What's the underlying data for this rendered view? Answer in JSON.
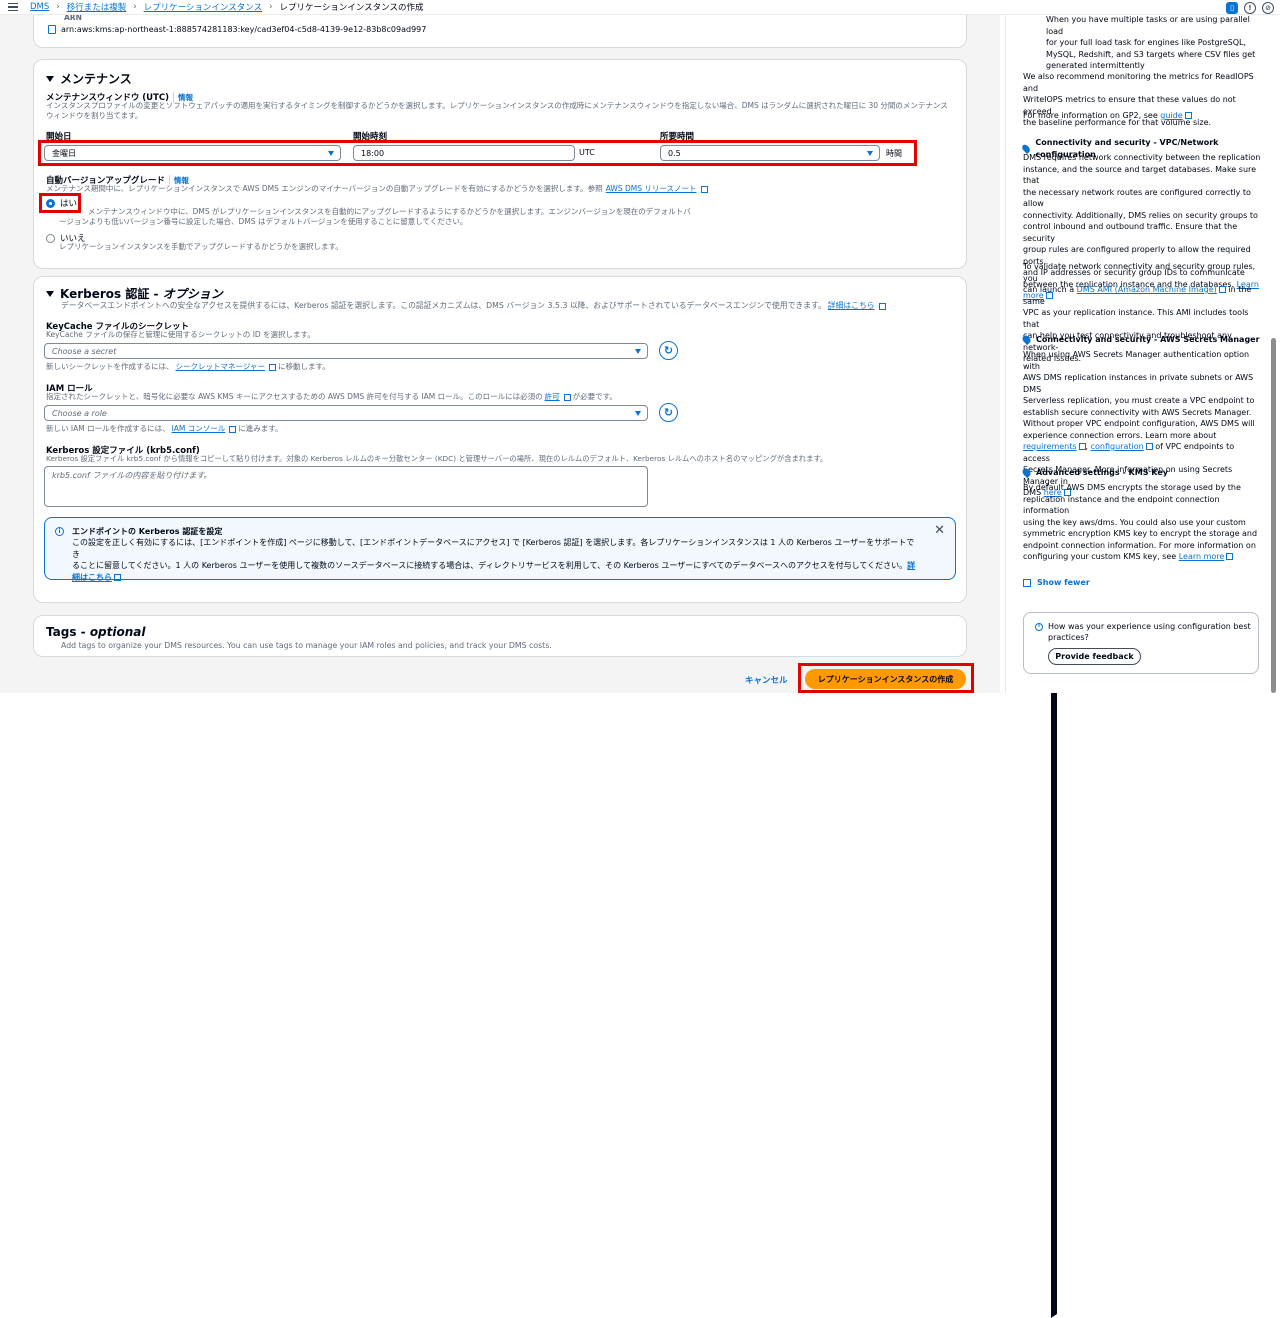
{
  "breadcrumb": {
    "root": "DMS",
    "level1": "移行または複製",
    "level2": "レプリケーションインスタンス",
    "current": "レプリケーションインスタンスの作成"
  },
  "arn": {
    "label": "ARN",
    "value": "arn:aws:kms:ap-northeast-1:888574281183:key/cad3ef04-c5d8-4139-9e12-83b8c09ad997"
  },
  "maintenance": {
    "title": "メンテナンス",
    "window_label": "メンテナンスウィンドウ (UTC)",
    "info": "情報",
    "window_desc": "インスタンスプロファイルの変更とソフトウェアパッチの適用を実行するタイミングを制御するかどうかを選択します。レプリケーションインスタンスの作成時にメンテナンスウィンドウを指定しない場合、DMS はランダムに選択された曜日に 30 分間のメンテナンスウィンドウを割り当てます。",
    "start_day_label": "開始日",
    "start_day_value": "金曜日",
    "start_time_label": "開始時刻",
    "start_time_value": "18:00",
    "tz": "UTC",
    "duration_label": "所要時間",
    "duration_value": "0.5",
    "duration_unit": "時間",
    "upgrade_label": "自動バージョンアップグレード",
    "upgrade_info": "情報",
    "upgrade_desc": "メンテナンス期間中に、レプリケーションインスタンスで AWS DMS エンジンのマイナーバージョンの自動アップグレードを有効にするかどうかを選択します。参照",
    "upgrade_link": "AWS DMS リリースノート",
    "yes_label": "はい",
    "yes_desc1": "メンテナンスウィンドウ中に、DMS がレプリケーションインスタンスを自動的にアップグレードするようにするかどうかを選択します。エンジンバージョンを現在のデフォルトバ",
    "yes_desc2": "ージョンよりも低いバージョン番号に設定した場合、DMS はデフォルトバージョンを使用することに留意してください。",
    "no_label": "いいえ",
    "no_desc": "レプリケーションインスタンスを手動でアップグレードするかどうかを選択します。"
  },
  "kerberos": {
    "title": "Kerberos 認証 - ",
    "title_opt": "オプション",
    "desc": "データベースエンドポイントへの安全なアクセスを提供するには、Kerberos 認証を選択します。この認証メカニズムは、DMS バージョン 3.5.3 以降、およびサポートされているデータベースエンジンで使用できます。",
    "desc_link": "詳細はこちら",
    "keycache_label": "KeyCache ファイルのシークレット",
    "keycache_desc": "KeyCache ファイルの保存と管理に使用するシークレットの ID を選択します。",
    "keycache_placeholder": "Choose a secret",
    "keycache_hint": "新しいシークレットを作成するには、",
    "keycache_hint_link": "シークレットマネージャー",
    "keycache_hint_end": "に移動します。",
    "iam_label": "IAM ロール",
    "iam_desc": "指定されたシークレットと、暗号化に必要な AWS KMS キーにアクセスするための AWS DMS 許可を付与する IAM ロール。このロールには必須の",
    "iam_desc_link": "許可",
    "iam_desc_end": "が必要です。",
    "iam_placeholder": "Choose a role",
    "iam_hint": "新しい IAM ロールを作成するには、",
    "iam_hint_link": "IAM コンソール",
    "iam_hint_end": "に進みます。",
    "krb5_label": "Kerberos 設定ファイル (krb5.conf)",
    "krb5_desc": "Kerberos 設定ファイル krb5.conf から情報をコピーして貼り付けます。対象の Kerberos レルムのキー分散センター (KDC) と管理サーバーの場所、現在のレルムのデフォルト、Kerberos レルムへのホスト名のマッピングが含まれます。",
    "krb5_placeholder": "krb5.conf ファイルの内容を貼り付けます。",
    "alert_title": "エンドポイントの Kerberos 認証を設定",
    "alert_l1": "この設定を正しく有効にするには、[エンドポイントを作成] ページに移動して、[エンドポイントデータベースにアクセス] で [Kerberos 認証] を選択します。各レプリケーションインスタンスは 1 人の Kerberos ユーザーをサポートでき",
    "alert_l2": "ることに留意してください。1 人の Kerberos ユーザーを使用して複数のソースデータベースに接続する場合は、ディレクトリサービスを利用して、その Kerberos ユーザーにすべてのデータベースへのアクセスを付与してください。",
    "alert_link1": "詳",
    "alert_link2": "細はこちら"
  },
  "tags": {
    "title": "Tags - ",
    "title_opt": "optional",
    "desc": "Add tags to organize your DMS resources. You can use tags to manage your IAM roles and policies, and track your DMS costs."
  },
  "footer": {
    "cancel": "キャンセル",
    "create": "レプリケーションインスタンスの作成"
  },
  "help": {
    "p0a": "When you have multiple tasks or are using parallel load",
    "p0b": "for your full load task for engines like PostgreSQL,",
    "p0c": "MySQL, Redshift, and S3 targets where CSV files get",
    "p0d": "generated intermittently",
    "p1a": "We also recommend monitoring the metrics for ReadIOPS and",
    "p1b": "WriteIOPS metrics to ensure that these values do not exceed",
    "p1c": "the baseline performance for that volume size.",
    "p2": "For more information on GP2, see",
    "p2link": "guide",
    "h1": "Connectivity and security - VPC/Network configuration",
    "s1": [
      "DMS requires network connectivity between the replication",
      "instance, and the source and target databases. Make sure that",
      "the necessary network routes are configured correctly to allow",
      "connectivity. Additionally, DMS relies on security groups to",
      "control inbound and outbound traffic. Ensure that the security",
      "group rules are configured properly to allow the required ports,",
      "and IP addresses or security group IDs to communicate",
      "between the replication instance and the databases."
    ],
    "s1link": "Learn",
    "s1link2": "more",
    "s2": [
      "To validate network connectivity and security group rules, you",
      "can launch a",
      "in the same",
      "VPC as your replication instance. This AMI includes tools that",
      "can help you test connectivity and troubleshoot any network-",
      "related issues."
    ],
    "s2link": "DMS AMI (Amazon Machine Image)",
    "h2": "Connectivity and security - AWS Secrets Manager",
    "s3": [
      "When using AWS Secrets Manager authentication option with",
      "AWS DMS replication instances in private subnets or AWS DMS",
      "Serverless replication, you must create a VPC endpoint to",
      "establish secure connectivity with AWS Secrets Manager.",
      "Without proper VPC endpoint configuration, AWS DMS will",
      "experience connection errors. Learn more about",
      ", ",
      "of VPC endpoints to access",
      "Secrets Manager. More information on using Secrets Manager in",
      "DMS"
    ],
    "s3l1": "requirements",
    "s3l2": "configuration",
    "s3l3": "here",
    "h3": "Advanced settings - KMS Key",
    "s4": [
      "By default AWS DMS encrypts the storage used by the",
      "replication instance and the endpoint connection information",
      "using the key aws/dms. You could also use your custom",
      "symmetric encryption KMS key to encrypt the storage and",
      "endpoint connection information. For more information on",
      "configuring your custom KMS key, see"
    ],
    "s4link": "Learn more",
    "show_fewer": "Show fewer",
    "fb_q1": "How was your experience using configuration best",
    "fb_q2": "practices?",
    "fb_btn": "Provide feedback"
  }
}
